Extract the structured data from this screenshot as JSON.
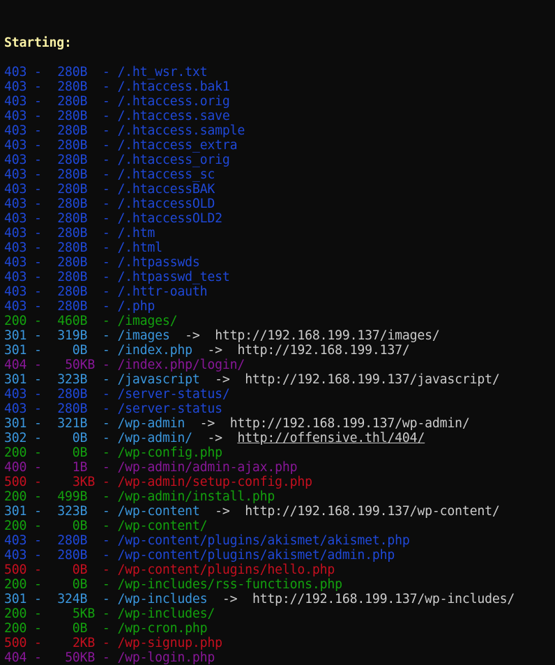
{
  "header": "Starting:",
  "arrow": "->",
  "separator": "-",
  "colors": {
    "403": "#1f48d8",
    "301": "#3a96dd",
    "302": "#3a96dd",
    "200": "#13a10e",
    "404": "#881798",
    "400": "#881798",
    "500": "#c50f1f",
    "text": "#cccccc",
    "header": "#f9f1a5",
    "background": "#0c0c0c"
  },
  "lines": [
    {
      "status": "403",
      "size": "280B",
      "path": "/.ht_wsr.txt"
    },
    {
      "status": "403",
      "size": "280B",
      "path": "/.htaccess.bak1"
    },
    {
      "status": "403",
      "size": "280B",
      "path": "/.htaccess.orig"
    },
    {
      "status": "403",
      "size": "280B",
      "path": "/.htaccess.save"
    },
    {
      "status": "403",
      "size": "280B",
      "path": "/.htaccess.sample"
    },
    {
      "status": "403",
      "size": "280B",
      "path": "/.htaccess_extra"
    },
    {
      "status": "403",
      "size": "280B",
      "path": "/.htaccess_orig"
    },
    {
      "status": "403",
      "size": "280B",
      "path": "/.htaccess_sc"
    },
    {
      "status": "403",
      "size": "280B",
      "path": "/.htaccessBAK"
    },
    {
      "status": "403",
      "size": "280B",
      "path": "/.htaccessOLD"
    },
    {
      "status": "403",
      "size": "280B",
      "path": "/.htaccessOLD2"
    },
    {
      "status": "403",
      "size": "280B",
      "path": "/.htm"
    },
    {
      "status": "403",
      "size": "280B",
      "path": "/.html"
    },
    {
      "status": "403",
      "size": "280B",
      "path": "/.htpasswds"
    },
    {
      "status": "403",
      "size": "280B",
      "path": "/.htpasswd_test"
    },
    {
      "status": "403",
      "size": "280B",
      "path": "/.httr-oauth"
    },
    {
      "status": "403",
      "size": "280B",
      "path": "/.php"
    },
    {
      "status": "200",
      "size": "460B",
      "path": "/images/"
    },
    {
      "status": "301",
      "size": "319B",
      "path": "/images",
      "redirect": "http://192.168.199.137/images/"
    },
    {
      "status": "301",
      "size": "0B",
      "path": "/index.php",
      "redirect": "http://192.168.199.137/"
    },
    {
      "status": "404",
      "size": "50KB",
      "path": "/index.php/login/"
    },
    {
      "status": "301",
      "size": "323B",
      "path": "/javascript",
      "redirect": "http://192.168.199.137/javascript/"
    },
    {
      "status": "403",
      "size": "280B",
      "path": "/server-status/"
    },
    {
      "status": "403",
      "size": "280B",
      "path": "/server-status"
    },
    {
      "status": "301",
      "size": "321B",
      "path": "/wp-admin",
      "redirect": "http://192.168.199.137/wp-admin/"
    },
    {
      "status": "302",
      "size": "0B",
      "path": "/wp-admin/",
      "redirect": "http://offensive.thl/404/",
      "underline": true
    },
    {
      "status": "200",
      "size": "0B",
      "path": "/wp-config.php"
    },
    {
      "status": "400",
      "size": "1B",
      "path": "/wp-admin/admin-ajax.php"
    },
    {
      "status": "500",
      "size": "3KB",
      "path": "/wp-admin/setup-config.php"
    },
    {
      "status": "200",
      "size": "499B",
      "path": "/wp-admin/install.php"
    },
    {
      "status": "301",
      "size": "323B",
      "path": "/wp-content",
      "redirect": "http://192.168.199.137/wp-content/"
    },
    {
      "status": "200",
      "size": "0B",
      "path": "/wp-content/"
    },
    {
      "status": "403",
      "size": "280B",
      "path": "/wp-content/plugins/akismet/akismet.php"
    },
    {
      "status": "403",
      "size": "280B",
      "path": "/wp-content/plugins/akismet/admin.php"
    },
    {
      "status": "500",
      "size": "0B",
      "path": "/wp-content/plugins/hello.php"
    },
    {
      "status": "200",
      "size": "0B",
      "path": "/wp-includes/rss-functions.php"
    },
    {
      "status": "301",
      "size": "324B",
      "path": "/wp-includes",
      "redirect": "http://192.168.199.137/wp-includes/"
    },
    {
      "status": "200",
      "size": "5KB",
      "path": "/wp-includes/"
    },
    {
      "status": "200",
      "size": "0B",
      "path": "/wp-cron.php"
    },
    {
      "status": "500",
      "size": "2KB",
      "path": "/wp-signup.php"
    },
    {
      "status": "404",
      "size": "50KB",
      "path": "/wp-login.php"
    }
  ]
}
